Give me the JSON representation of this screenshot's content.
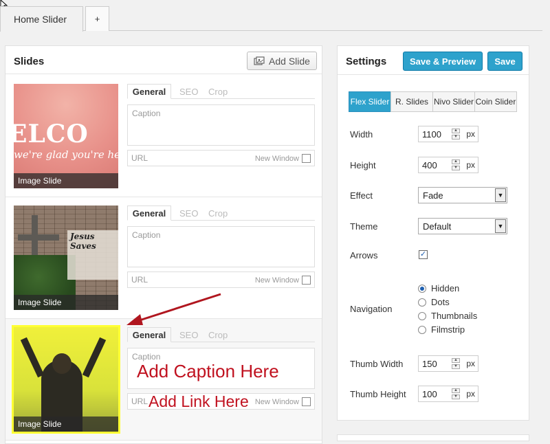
{
  "tabs": {
    "active": "Home Slider",
    "add": "+"
  },
  "slides_panel": {
    "title": "Slides",
    "add_label": "Add Slide",
    "slides": [
      {
        "thumb_label": "Image Slide",
        "thumb_text_1": "ELCO",
        "thumb_text_2": "we're glad you're here",
        "tab_general": "General",
        "tab_seo": "SEO",
        "tab_crop": "Crop",
        "caption_placeholder": "Caption",
        "url_placeholder": "URL",
        "new_window": "New Window"
      },
      {
        "thumb_label": "Image Slide",
        "thumb_text_1": "Jesus Saves",
        "tab_general": "General",
        "tab_seo": "SEO",
        "tab_crop": "Crop",
        "caption_placeholder": "Caption",
        "url_placeholder": "URL",
        "new_window": "New Window"
      },
      {
        "thumb_label": "Image Slide",
        "tab_general": "General",
        "tab_seo": "SEO",
        "tab_crop": "Crop",
        "caption_placeholder": "Caption",
        "url_placeholder": "URL",
        "new_window": "New Window",
        "note_caption": "Add Caption Here",
        "note_url": "Add Link Here"
      }
    ]
  },
  "settings": {
    "title": "Settings",
    "save_preview": "Save & Preview",
    "save": "Save",
    "slider_tabs": [
      "Flex Slider",
      "R. Slides",
      "Nivo Slider",
      "Coin Slider"
    ],
    "width_label": "Width",
    "width_value": "1100",
    "height_label": "Height",
    "height_value": "400",
    "unit": "px",
    "effect_label": "Effect",
    "effect_value": "Fade",
    "theme_label": "Theme",
    "theme_value": "Default",
    "arrows_label": "Arrows",
    "arrows_checked": true,
    "navigation_label": "Navigation",
    "navigation_options": [
      "Hidden",
      "Dots",
      "Thumbnails",
      "Filmstrip"
    ],
    "navigation_selected": "Hidden",
    "thumb_width_label": "Thumb Width",
    "thumb_width_value": "150",
    "thumb_height_label": "Thumb Height",
    "thumb_height_value": "100"
  },
  "colors": {
    "accent": "#2ea2cc",
    "annotation": "#c0111f",
    "highlight": "#ffff33"
  }
}
